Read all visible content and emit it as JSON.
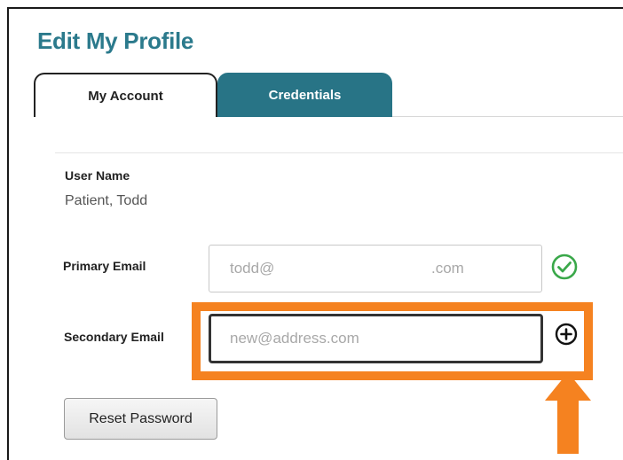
{
  "page": {
    "title": "Edit My Profile"
  },
  "tabs": [
    {
      "label": "My Account",
      "active": true
    },
    {
      "label": "Credentials",
      "active": false
    }
  ],
  "profile": {
    "user_name_label": "User Name",
    "user_name_value": "Patient, Todd",
    "primary_email_label": "Primary Email",
    "primary_email_value_start": "todd@",
    "primary_email_value_end": ".com",
    "primary_email_status_icon": "check-circle-icon",
    "secondary_email_label": "Secondary Email",
    "secondary_email_placeholder": "new@address.com",
    "secondary_email_action_icon": "plus-circle-icon"
  },
  "actions": {
    "reset_password_label": "Reset Password"
  },
  "colors": {
    "title": "#2b7a8c",
    "tab_inactive_bg": "#287486",
    "highlight": "#f58220",
    "check": "#3aa84a"
  }
}
